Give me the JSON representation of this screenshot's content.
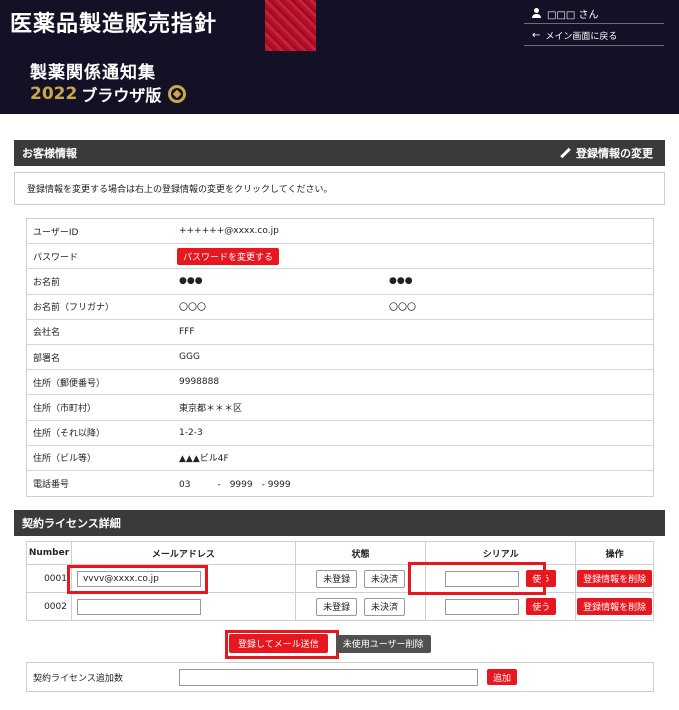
{
  "header": {
    "title": "医薬品製造販売指針",
    "subtitle": "製薬関係通知集",
    "year": "2022",
    "edition": "ブラウザ版",
    "user_name": "□□□ さん",
    "back_link": "メイン画面に戻る"
  },
  "customer_section": {
    "title": "お客様情報",
    "edit_link": "登録情報の変更",
    "notice": "登録情報を変更する場合は右上の登録情報の変更をクリックしてください。"
  },
  "info_rows": {
    "user_id": {
      "label": "ユーザーID",
      "value": "++++++@xxxx.co.jp"
    },
    "password": {
      "label": "パスワード",
      "button": "パスワードを変更する"
    },
    "name": {
      "label": "お名前",
      "last": "●●●",
      "first": "●●●"
    },
    "kana": {
      "label": "お名前（フリガナ）",
      "last": "〇〇〇",
      "first": "〇〇〇"
    },
    "company": {
      "label": "会社名",
      "value": "FFF"
    },
    "dept": {
      "label": "部署名",
      "value": "GGG"
    },
    "zip": {
      "label": "住所（郵便番号）",
      "value": "9998888"
    },
    "city": {
      "label": "住所（市町村）",
      "value": "東京都＊＊＊区"
    },
    "street": {
      "label": "住所（それ以降）",
      "value": "1-2-3"
    },
    "building": {
      "label": "住所（ビル等）",
      "value": "▲▲▲ビル4F"
    },
    "phone": {
      "label": "電話番号",
      "value": "03　　　-　9999　- 9999"
    }
  },
  "license_section": {
    "title": "契約ライセンス詳細",
    "headers": {
      "number": "Number",
      "email": "メールアドレス",
      "status": "状態",
      "serial": "シリアル",
      "action": "操作"
    },
    "rows": [
      {
        "number": "0001",
        "email": "vvvv@xxxx.co.jp",
        "status_a": "未登録",
        "status_b": "未決済",
        "serial": "",
        "use": "使う",
        "delete": "登録情報を削除"
      },
      {
        "number": "0002",
        "email": "",
        "status_a": "未登録",
        "status_b": "未決済",
        "serial": "",
        "use": "使う",
        "delete": "登録情報を削除"
      }
    ],
    "register_button": "登録してメール送信",
    "unused_delete_button": "未使用ユーザー削除",
    "add_label": "契約ライセンス追加数",
    "add_value": "",
    "add_button": "追加"
  },
  "colors": {
    "header_bg": "#141127",
    "section_bg": "#3a3a3a",
    "accent_red": "#e8171f",
    "gold": "#c8a84a"
  }
}
